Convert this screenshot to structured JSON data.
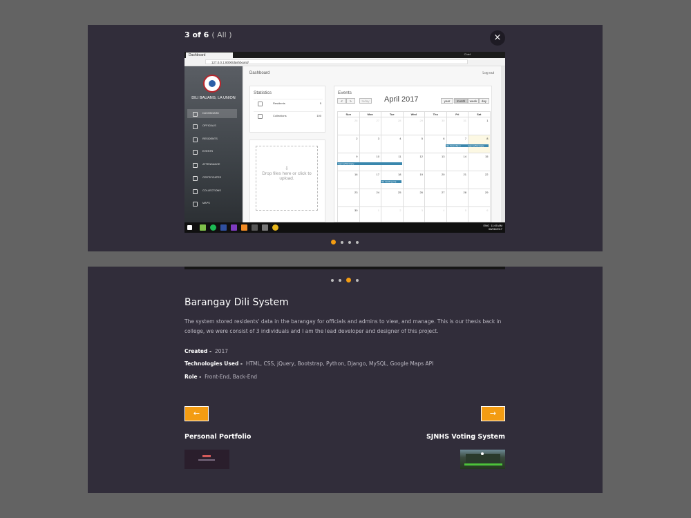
{
  "viewer": {
    "counter": "3 of 6",
    "filter": "( All )",
    "close_symbol": "×",
    "slide_dots": 4,
    "active_dot_top": 0,
    "active_dot_bottom": 2
  },
  "screenshot": {
    "browser_tab": "Dashboard",
    "url": "127.0.0.1:8000/dashboard/",
    "window_user": "Chief",
    "brand": "DILI BAUANG, LA UNION",
    "nav_items": [
      "DASHBOARD",
      "OFFICIALS",
      "RESIDENTS",
      "EVENTS",
      "ATTENDANCE",
      "CERTIFICATES",
      "COLLECTIONS",
      "MAPS"
    ],
    "page_title": "Dashboard",
    "logout": "Log out",
    "statistics_title": "Statistics",
    "stats": [
      {
        "label": "Residents",
        "value": "5"
      },
      {
        "label": "Collections",
        "value": "100"
      }
    ],
    "dropzone_text": "Drop files here or click to upload.",
    "events_title": "Events",
    "calendar": {
      "month": "April 2017",
      "today_btn": "today",
      "prev": "<",
      "next": ">",
      "views": [
        "year",
        "month",
        "week",
        "day"
      ],
      "days": [
        "Sun",
        "Mon",
        "Tue",
        "Wed",
        "Thu",
        "Fri",
        "Sat"
      ],
      "weeks": [
        [
          "26",
          "27",
          "28",
          "29",
          "30",
          "31",
          "1"
        ],
        [
          "2",
          "3",
          "4",
          "5",
          "6",
          "7",
          "8"
        ],
        [
          "9",
          "10",
          "11",
          "12",
          "13",
          "14",
          "15"
        ],
        [
          "16",
          "17",
          "18",
          "19",
          "20",
          "21",
          "22"
        ],
        [
          "23",
          "24",
          "25",
          "26",
          "27",
          "28",
          "29"
        ],
        [
          "30",
          "1",
          "2",
          "3",
          "4",
          "5",
          "6"
        ]
      ],
      "events": [
        "Ika Assembly m",
        "Liga ng Barangay",
        "Liga ng Barangay",
        "Ika meeting proj"
      ]
    },
    "clock_time": "11:05 AM",
    "clock_date": "08/06/2017",
    "tray_lang": "ENG"
  },
  "project": {
    "title": "Barangay Dili System",
    "description": "The system stored residents' data in the barangay for officials and admins to view, and manage. This is our thesis back in college, we were consist of 3 individuals and I am the lead developer and designer of this project.",
    "created_label": "Created -",
    "created_value": "2017",
    "tech_label": "Technologies Used -",
    "tech_value": "HTML, CSS, jQuery, Bootstrap, Python, Django, MySQL, Google Maps API",
    "role_label": "Role -",
    "role_value": "Front-End, Back-End"
  },
  "navigation": {
    "prev_label": "Personal Portfolio",
    "next_label": "SJNHS Voting System",
    "prev_arrow": "←",
    "next_arrow": "→"
  },
  "colors": {
    "accent": "#f39c12",
    "panel": "#312d3a",
    "backdrop": "#636363"
  }
}
